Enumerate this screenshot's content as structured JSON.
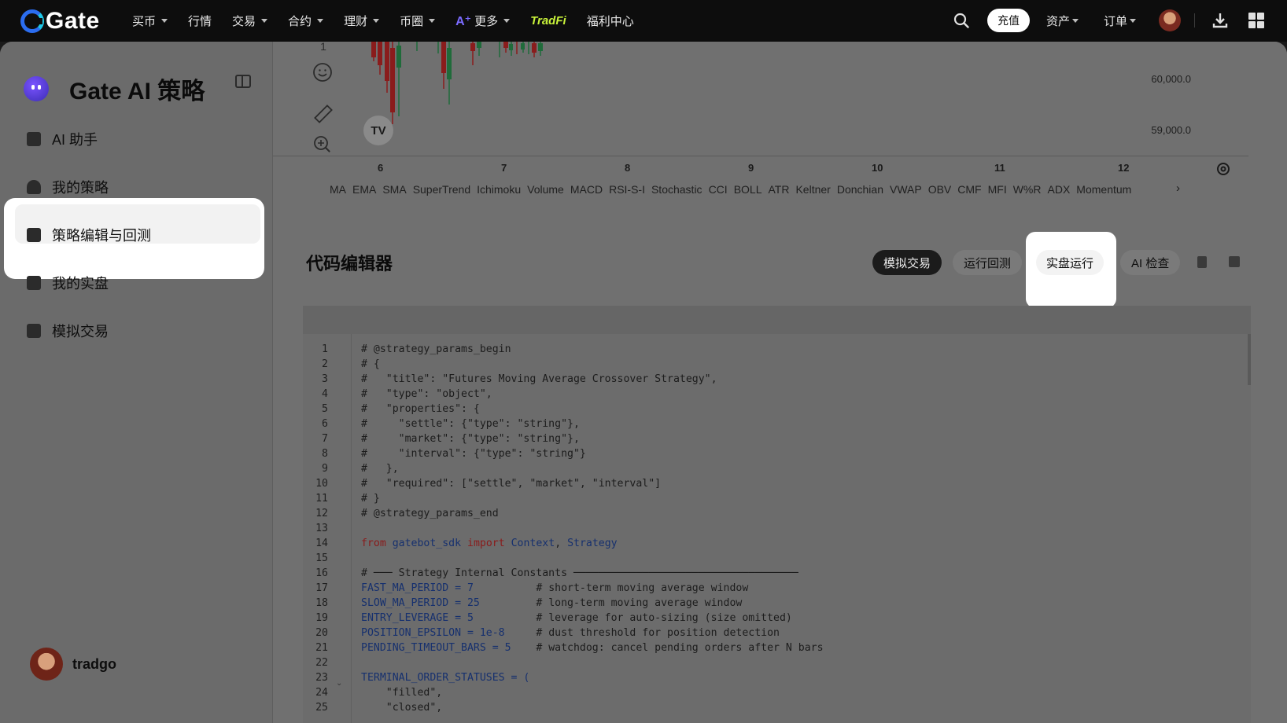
{
  "topnav": {
    "logo": "Gate",
    "items": [
      {
        "label": "买币",
        "caret": true
      },
      {
        "label": "行情",
        "caret": false
      },
      {
        "label": "交易",
        "caret": true
      },
      {
        "label": "合约",
        "caret": true
      },
      {
        "label": "理财",
        "caret": true
      },
      {
        "label": "币圈",
        "caret": true
      },
      {
        "label": "更多",
        "caret": true,
        "ai": true
      },
      {
        "label": "TradFi",
        "caret": false,
        "tradfi": true
      },
      {
        "label": "福利中心",
        "caret": false
      }
    ],
    "deposit_label": "充值",
    "assets_label": "资产",
    "orders_label": "订单"
  },
  "sidebar": {
    "title": "Gate AI 策略",
    "items": [
      {
        "label": "AI 助手",
        "icon": "ai-assistant-icon"
      },
      {
        "label": "我的策略",
        "icon": "strategy-icon"
      },
      {
        "label": "策略编辑与回测",
        "icon": "edit-icon",
        "active": true
      },
      {
        "label": "我的实盘",
        "icon": "live-chart-icon"
      },
      {
        "label": "模拟交易",
        "icon": "simulate-icon"
      }
    ],
    "username": "tradgo"
  },
  "chart": {
    "price_labels": [
      "60,000.0",
      "59,000.0"
    ],
    "x_labels": [
      "6",
      "7",
      "8",
      "9",
      "10",
      "11",
      "12"
    ],
    "tool_top": "1",
    "tv_badge": "TV",
    "indicators": [
      "MA",
      "EMA",
      "SMA",
      "SuperTrend",
      "Ichimoku",
      "Volume",
      "MACD",
      "RSI-S-I",
      "Stochastic",
      "CCI",
      "BOLL",
      "ATR",
      "Keltner",
      "Donchian",
      "VWAP",
      "OBV",
      "CMF",
      "MFI",
      "W%R",
      "ADX",
      "Momentum"
    ],
    "more": "›"
  },
  "editor": {
    "title": "代码编辑器",
    "btn_sim": "模拟交易",
    "btn_backtest": "运行回测",
    "btn_live": "实盘运行",
    "btn_check": "AI 检查",
    "lines": [
      "# @strategy_params_begin",
      "# {",
      "#   \"title\": \"Futures Moving Average Crossover Strategy\",",
      "#   \"type\": \"object\",",
      "#   \"properties\": {",
      "#     \"settle\": {\"type\": \"string\"},",
      "#     \"market\": {\"type\": \"string\"},",
      "#     \"interval\": {\"type\": \"string\"}",
      "#   },",
      "#   \"required\": [\"settle\", \"market\", \"interval\"]",
      "# }",
      "# @strategy_params_end",
      "",
      "from gatebot_sdk import Context, Strategy",
      "",
      "# ─── Strategy Internal Constants ────────────────────────────────────",
      "FAST_MA_PERIOD = 7          # short-term moving average window",
      "SLOW_MA_PERIOD = 25         # long-term moving average window",
      "ENTRY_LEVERAGE = 5          # leverage for auto-sizing (size omitted)",
      "POSITION_EPSILON = 1e-8     # dust threshold for position detection",
      "PENDING_TIMEOUT_BARS = 5    # watchdog: cancel pending orders after N bars",
      "",
      "TERMINAL_ORDER_STATUSES = (",
      "    \"filled\",",
      "    \"closed\","
    ]
  }
}
